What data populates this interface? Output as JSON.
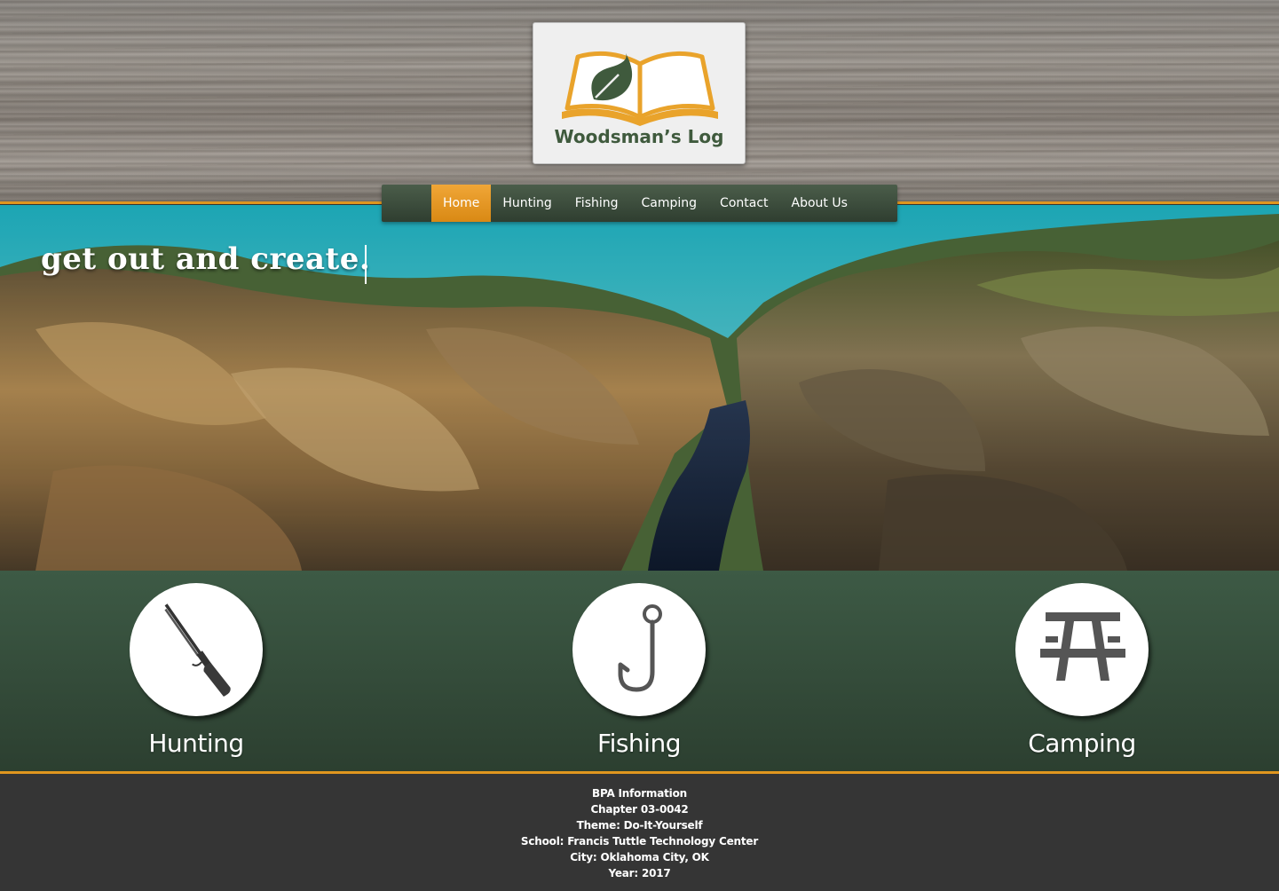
{
  "brand": {
    "name": "Woodsman’s Log",
    "colors": {
      "accent": "#e0961f",
      "green": "#3d5a45",
      "logo_green": "#3f5a3d"
    }
  },
  "nav": {
    "items": [
      {
        "label": "Home",
        "active": true
      },
      {
        "label": "Hunting"
      },
      {
        "label": "Fishing"
      },
      {
        "label": "Camping"
      },
      {
        "label": "Contact"
      },
      {
        "label": "About Us"
      }
    ]
  },
  "hero": {
    "tagline": "get out and create."
  },
  "features": [
    {
      "label": "Hunting",
      "icon": "rifle-icon"
    },
    {
      "label": "Fishing",
      "icon": "fish-hook-icon"
    },
    {
      "label": "Camping",
      "icon": "picnic-table-icon"
    }
  ],
  "footer": {
    "lines": [
      "BPA Information",
      "Chapter 03-0042",
      "Theme: Do-It-Yourself",
      "School: Francis Tuttle Technology Center",
      "City: Oklahoma City, OK",
      "Year: 2017"
    ]
  }
}
